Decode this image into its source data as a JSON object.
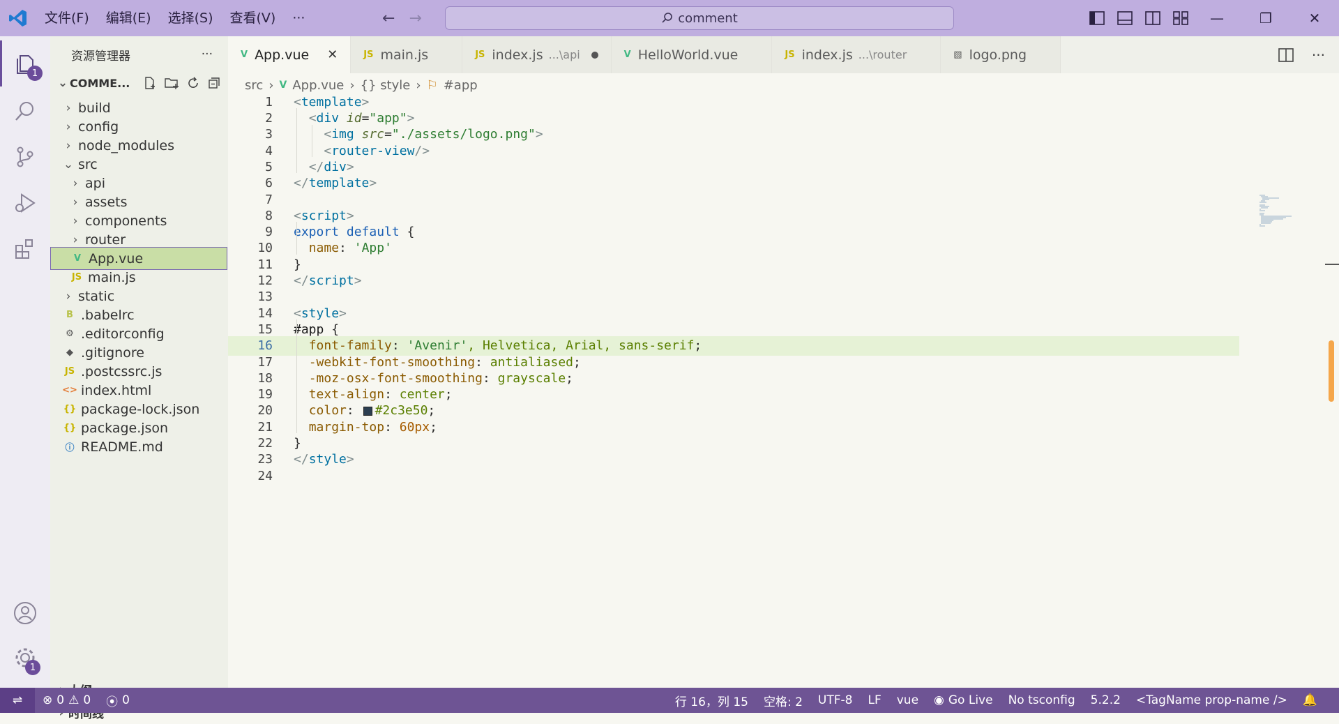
{
  "menu": [
    "文件(F)",
    "编辑(E)",
    "选择(S)",
    "查看(V)",
    "···"
  ],
  "command_center": {
    "text": "comment"
  },
  "explorer": {
    "title": "资源管理器",
    "more": "···",
    "root": "COMME...",
    "tree": [
      {
        "label": "build",
        "type": "folder",
        "depth": 0,
        "icon": ""
      },
      {
        "label": "config",
        "type": "folder",
        "depth": 0,
        "icon": ""
      },
      {
        "label": "node_modules",
        "type": "folder",
        "depth": 0,
        "icon": ""
      },
      {
        "label": "src",
        "type": "folder-open",
        "depth": 0,
        "icon": ""
      },
      {
        "label": "api",
        "type": "folder",
        "depth": 1,
        "icon": ""
      },
      {
        "label": "assets",
        "type": "folder",
        "depth": 1,
        "icon": ""
      },
      {
        "label": "components",
        "type": "folder",
        "depth": 1,
        "icon": ""
      },
      {
        "label": "router",
        "type": "folder",
        "depth": 1,
        "icon": ""
      },
      {
        "label": "App.vue",
        "type": "file",
        "depth": 1,
        "icon": "V",
        "selected": true
      },
      {
        "label": "main.js",
        "type": "file",
        "depth": 1,
        "icon": "JS"
      },
      {
        "label": "static",
        "type": "folder",
        "depth": 0,
        "icon": ""
      },
      {
        "label": ".babelrc",
        "type": "file",
        "depth": 0,
        "icon": "B"
      },
      {
        "label": ".editorconfig",
        "type": "file",
        "depth": 0,
        "icon": "⚙"
      },
      {
        "label": ".gitignore",
        "type": "file",
        "depth": 0,
        "icon": "◆"
      },
      {
        "label": ".postcssrc.js",
        "type": "file",
        "depth": 0,
        "icon": "JS"
      },
      {
        "label": "index.html",
        "type": "file",
        "depth": 0,
        "icon": "<>"
      },
      {
        "label": "package-lock.json",
        "type": "file",
        "depth": 0,
        "icon": "{}"
      },
      {
        "label": "package.json",
        "type": "file",
        "depth": 0,
        "icon": "{}"
      },
      {
        "label": "README.md",
        "type": "file",
        "depth": 0,
        "icon": "ⓘ"
      }
    ],
    "outline": "大纲",
    "timeline": "时间线"
  },
  "activity_badges": {
    "explorer": "1",
    "settings": "1"
  },
  "tabs": [
    {
      "label": "App.vue",
      "icon": "V",
      "sub": "",
      "active": true,
      "close": "✕"
    },
    {
      "label": "main.js",
      "icon": "JS",
      "sub": ""
    },
    {
      "label": "index.js",
      "icon": "JS",
      "sub": "...\\api",
      "dirty": true
    },
    {
      "label": "HelloWorld.vue",
      "icon": "V",
      "sub": ""
    },
    {
      "label": "index.js",
      "icon": "JS",
      "sub": "...\\router"
    },
    {
      "label": "logo.png",
      "icon": "▧",
      "sub": ""
    }
  ],
  "breadcrumb": [
    "src",
    "App.vue",
    "{} style",
    "#app"
  ],
  "code_lines": [
    [
      [
        "t-br",
        "<"
      ],
      [
        "t-tag",
        "template"
      ],
      [
        "t-br",
        ">"
      ]
    ],
    [
      [
        "",
        "  "
      ],
      [
        "t-br",
        "<"
      ],
      [
        "t-tag",
        "div"
      ],
      [
        "",
        " "
      ],
      [
        "t-attr",
        "id"
      ],
      [
        "",
        "="
      ],
      [
        "t-str",
        "\"app\""
      ],
      [
        "t-br",
        ">"
      ]
    ],
    [
      [
        "",
        "    "
      ],
      [
        "t-br",
        "<"
      ],
      [
        "t-tag",
        "img"
      ],
      [
        "",
        " "
      ],
      [
        "t-attr",
        "src"
      ],
      [
        "",
        "="
      ],
      [
        "t-str",
        "\"./assets/logo.png\""
      ],
      [
        "t-br",
        ">"
      ]
    ],
    [
      [
        "",
        "    "
      ],
      [
        "t-br",
        "<"
      ],
      [
        "t-tag",
        "router-view"
      ],
      [
        "t-br",
        "/>"
      ]
    ],
    [
      [
        "",
        "  "
      ],
      [
        "t-br",
        "</"
      ],
      [
        "t-tag",
        "div"
      ],
      [
        "t-br",
        ">"
      ]
    ],
    [
      [
        "t-br",
        "</"
      ],
      [
        "t-tag",
        "template"
      ],
      [
        "t-br",
        ">"
      ]
    ],
    [],
    [
      [
        "t-br",
        "<"
      ],
      [
        "t-tag",
        "script"
      ],
      [
        "t-br",
        ">"
      ]
    ],
    [
      [
        "t-kw",
        "export default"
      ],
      [
        "",
        " {"
      ]
    ],
    [
      [
        "",
        "  "
      ],
      [
        "t-prop",
        "name"
      ],
      [
        "",
        ": "
      ],
      [
        "t-str",
        "'App'"
      ]
    ],
    [
      [
        "",
        "}"
      ]
    ],
    [
      [
        "t-br",
        "</"
      ],
      [
        "t-tag",
        "script"
      ],
      [
        "t-br",
        ">"
      ]
    ],
    [],
    [
      [
        "t-br",
        "<"
      ],
      [
        "t-tag",
        "style"
      ],
      [
        "t-br",
        ">"
      ]
    ],
    [
      [
        "t-sel",
        "#app"
      ],
      [
        "",
        " {"
      ]
    ],
    [
      [
        "",
        "  "
      ],
      [
        "t-prop",
        "font-family"
      ],
      [
        "",
        ": "
      ],
      [
        "t-str",
        "'Avenir'"
      ],
      [
        "t-val",
        ", Helvetica, Arial, sans-serif"
      ],
      [
        "",
        ";"
      ]
    ],
    [
      [
        "",
        "  "
      ],
      [
        "t-prop",
        "-webkit-font-smoothing"
      ],
      [
        "",
        ": "
      ],
      [
        "t-val",
        "antialiased"
      ],
      [
        "",
        ";"
      ]
    ],
    [
      [
        "",
        "  "
      ],
      [
        "t-prop",
        "-moz-osx-font-smoothing"
      ],
      [
        "",
        ": "
      ],
      [
        "t-val",
        "grayscale"
      ],
      [
        "",
        ";"
      ]
    ],
    [
      [
        "",
        "  "
      ],
      [
        "t-prop",
        "text-align"
      ],
      [
        "",
        ": "
      ],
      [
        "t-val",
        "center"
      ],
      [
        "",
        ";"
      ]
    ],
    [
      [
        "",
        "  "
      ],
      [
        "t-prop",
        "color"
      ],
      [
        "",
        ": "
      ],
      [
        "swatch",
        ""
      ],
      [
        "t-val",
        "#2c3e50"
      ],
      [
        "",
        ";"
      ]
    ],
    [
      [
        "",
        "  "
      ],
      [
        "t-prop",
        "margin-top"
      ],
      [
        "",
        ": "
      ],
      [
        "t-num",
        "60px"
      ],
      [
        "",
        ";"
      ]
    ],
    [
      [
        "",
        "}"
      ]
    ],
    [
      [
        "t-br",
        "</"
      ],
      [
        "t-tag",
        "style"
      ],
      [
        "t-br",
        ">"
      ]
    ],
    []
  ],
  "current_line": 16,
  "status": {
    "errors": "0",
    "warnings": "0",
    "ports": "0",
    "position": "行 16，列 15",
    "spaces": "空格: 2",
    "encoding": "UTF-8",
    "eol": "LF",
    "language": "vue",
    "golive": "Go Live",
    "tsconfig": "No tsconfig",
    "version": "5.2.2",
    "snippet": "<TagName prop-name />"
  },
  "colors": {
    "titlebar": "#bfaedf",
    "statusbar": "#6e5494",
    "selection": "#c9dea6",
    "swatch": "#2c3e50"
  }
}
